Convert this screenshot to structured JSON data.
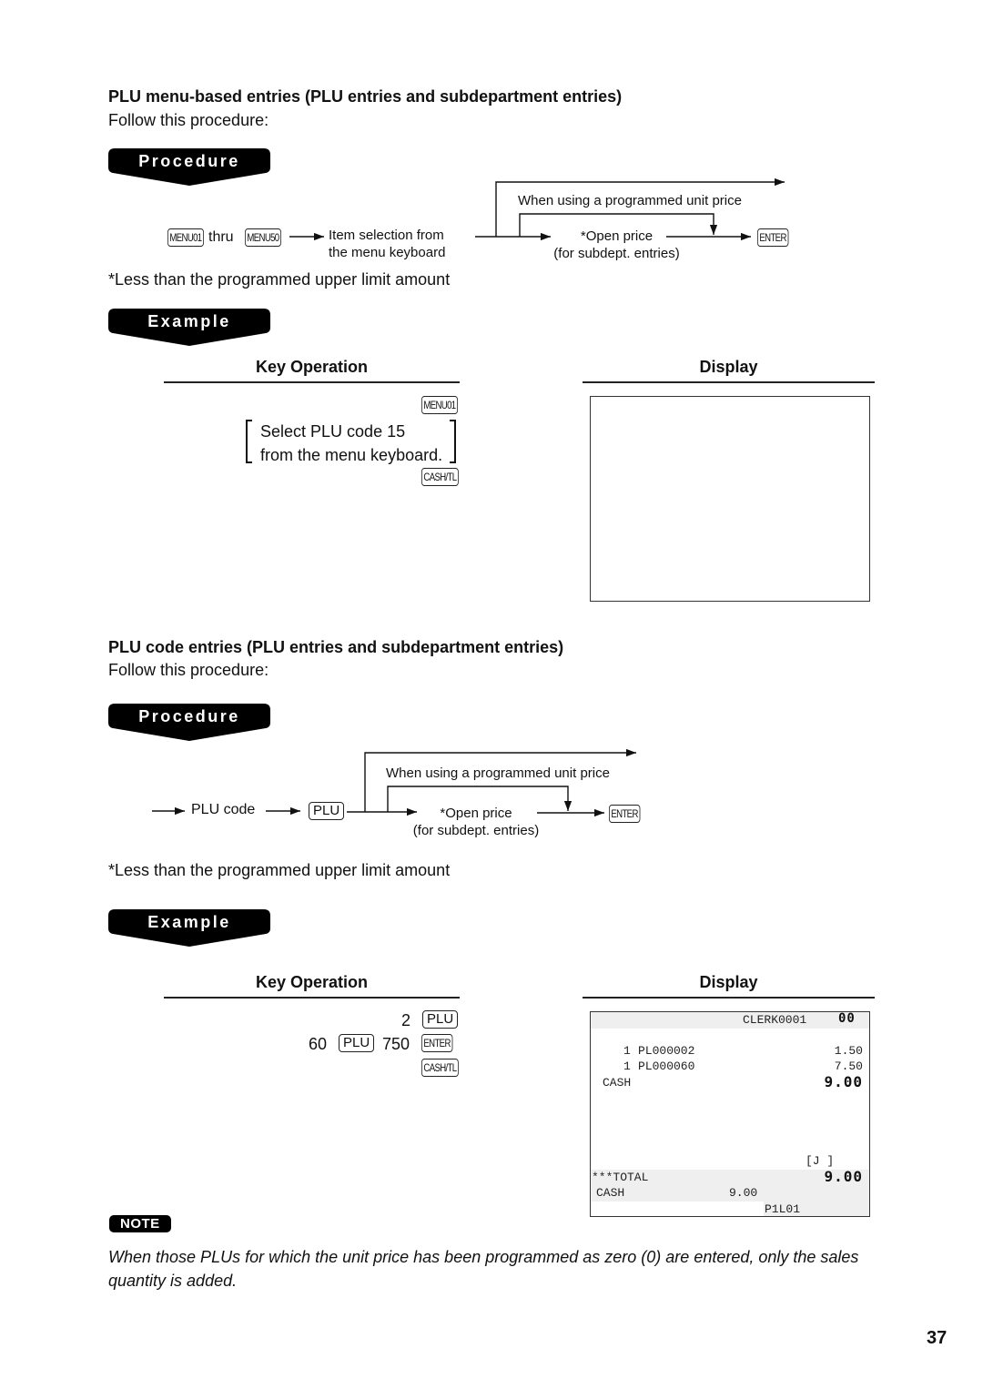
{
  "section1": {
    "title": "PLU menu-based entries (PLU entries and subdepartment entries)",
    "intro": "Follow this procedure:",
    "procedure_label": "Procedure",
    "flow": {
      "start_key_1": "MENU01",
      "thru": "thru",
      "start_key_2": "MENU50",
      "step1_line1": "Item selection from",
      "step1_line2": "the menu keyboard",
      "bypass_label": "When using a programmed unit price",
      "open_price_line1": "*Open price",
      "open_price_line2": "(for subdept. entries)",
      "end_key": "ENTER"
    },
    "footnote": "*Less than the programmed upper limit amount",
    "example_label": "Example",
    "key_operation_header": "Key Operation",
    "display_header": "Display",
    "key_ops": {
      "key1": "MENU01",
      "bracket_line1": "Select PLU code 15",
      "bracket_line2": "from the menu keyboard.",
      "key2": "CASH/TL"
    }
  },
  "section2": {
    "title": "PLU code entries (PLU entries and subdepartment entries)",
    "intro": "Follow this procedure:",
    "procedure_label": "Procedure",
    "flow": {
      "step1": "PLU code",
      "key1": "PLU",
      "bypass_label": "When using a programmed unit price",
      "open_price_line1": "*Open price",
      "open_price_line2": "(for subdept. entries)",
      "end_key": "ENTER"
    },
    "footnote": "*Less than the programmed upper limit amount",
    "example_label": "Example",
    "key_operation_header": "Key Operation",
    "display_header": "Display",
    "key_ops": {
      "row1_value": "2",
      "row1_key": "PLU",
      "row2_value1": "60",
      "row2_key1": "PLU",
      "row2_value2": "750",
      "row2_key2": "ENTER",
      "row3_key": "CASH/TL"
    },
    "display": {
      "clerk": "CLERK0001",
      "header_code": "00",
      "items": [
        {
          "qty": "1",
          "name": "PL000002",
          "amount": "1.50"
        },
        {
          "qty": "1",
          "name": "PL000060",
          "amount": "7.50"
        }
      ],
      "cash_label": "CASH",
      "cash_amount": "9.00",
      "journal_indicator": "[J ]",
      "total_label": "***TOTAL",
      "total_amount": "9.00",
      "footer_cash_label": "CASH",
      "footer_cash_amount": "9.00",
      "footer_code": "P1L01"
    }
  },
  "note": {
    "badge": "NOTE",
    "text": "When those PLUs for which the unit price has been programmed as zero (0) are entered, only the sales quantity is added."
  },
  "page_number": "37"
}
